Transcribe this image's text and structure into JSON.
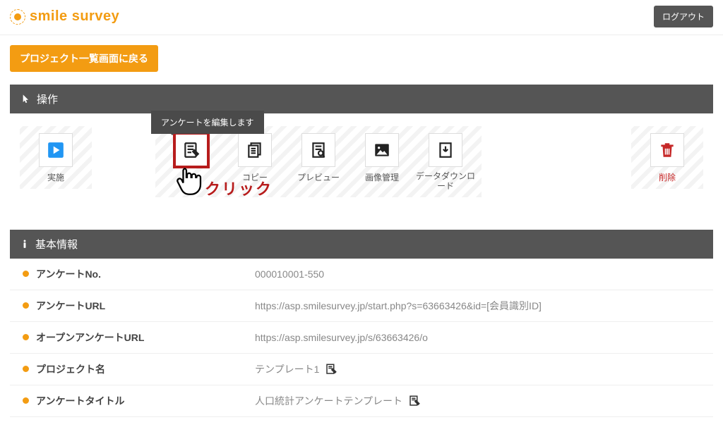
{
  "header": {
    "logo_text": "smile survey",
    "logout_label": "ログアウト"
  },
  "back_button_label": "プロジェクト一覧画面に戻る",
  "ops_panel": {
    "title": "操作",
    "tooltip": "アンケートを編集します",
    "click_annotation": "クリック",
    "actions": {
      "run": "実施",
      "edit": "編集",
      "copy": "コピー",
      "preview": "プレビュー",
      "image": "画像管理",
      "download": "データダウンロード",
      "delete": "削除"
    }
  },
  "info_panel": {
    "title": "基本情報",
    "rows": {
      "survey_no": {
        "label": "アンケートNo.",
        "value": "000010001-550"
      },
      "survey_url": {
        "label": "アンケートURL",
        "value": "https://asp.smilesurvey.jp/start.php?s=63663426&id=[会員識別ID]"
      },
      "open_url": {
        "label": "オープンアンケートURL",
        "value": "https://asp.smilesurvey.jp/s/63663426/o"
      },
      "project_name": {
        "label": "プロジェクト名",
        "value": "テンプレート1"
      },
      "survey_title": {
        "label": "アンケートタイトル",
        "value": "人口統計アンケートテンプレート"
      }
    }
  }
}
